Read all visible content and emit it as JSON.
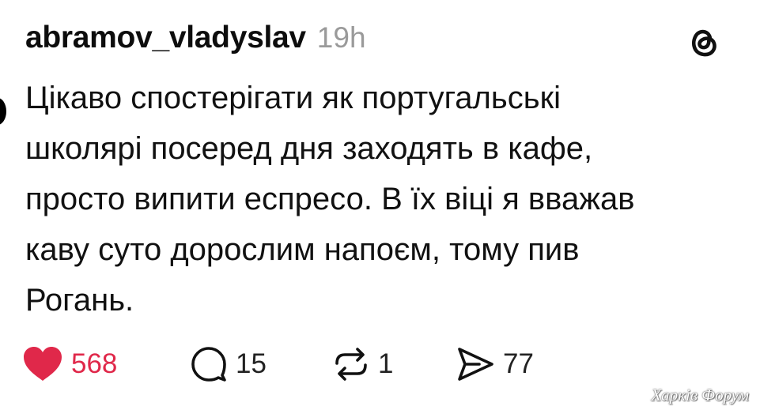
{
  "post": {
    "username": "abramov_vladyslav",
    "timestamp": "19h",
    "text_lines": [
      "Цікаво спостерігати як португальські",
      "школярі посеред дня заходять в кафе,",
      "просто випити еспресо. В їх віці я вважав",
      "каву суто дорослим напоєм, тому пив",
      "Рогань."
    ]
  },
  "actions": {
    "like": {
      "icon": "heart-icon",
      "count": "568",
      "liked": true,
      "color": "#e0284a"
    },
    "reply": {
      "icon": "comment-icon",
      "count": "15"
    },
    "repost": {
      "icon": "repost-icon",
      "count": "1"
    },
    "share": {
      "icon": "send-icon",
      "count": "77"
    }
  },
  "branding": {
    "app_icon": "threads-logo-icon",
    "watermark": "Харків Форум"
  }
}
